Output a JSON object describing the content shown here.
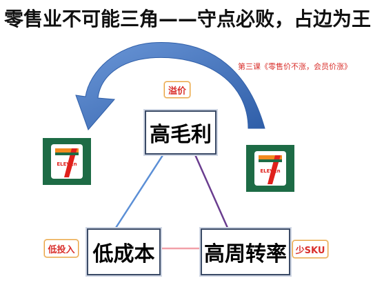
{
  "title": "零售业不可能三角——守点必败，占边为王",
  "subtitle": "第三课《零售价不涨，会员价涨》",
  "nodes": {
    "top": "高毛利",
    "left": "低成本",
    "right": "高周转率"
  },
  "tags": {
    "top": "溢价",
    "left": "低投入",
    "right": "少SKU"
  },
  "logo": {
    "text": "ELEVEn",
    "icon": "seven-eleven-logo-icon"
  },
  "colors": {
    "arrow": "#4a79c4",
    "edge_left": "#5b8fd6",
    "edge_right": "#6a3d8f",
    "edge_bottom": "#f2a0a8",
    "tag_text": "#d9302c",
    "logo_bg": "#1d6b45",
    "logo_red": "#e0201b",
    "logo_orange": "#f28a1e"
  }
}
